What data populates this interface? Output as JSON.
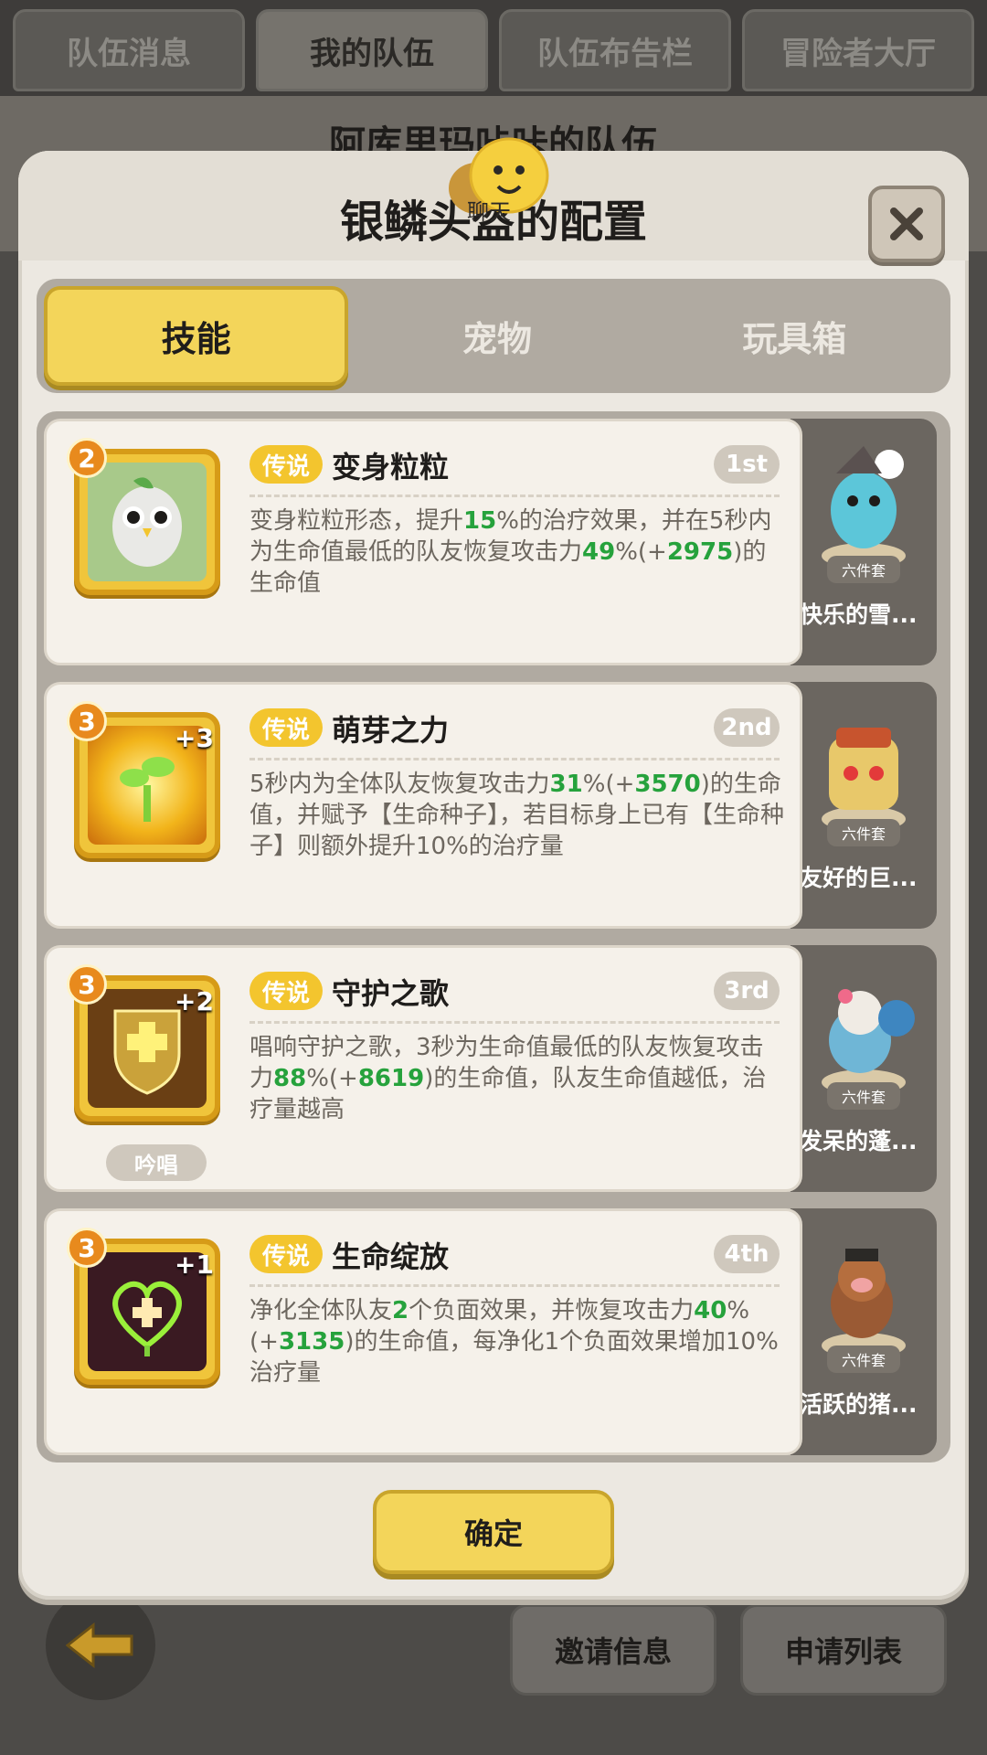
{
  "top_tabs": [
    {
      "label": "队伍消息"
    },
    {
      "label": "我的队伍",
      "active": true
    },
    {
      "label": "队伍布告栏"
    },
    {
      "label": "冒险者大厅"
    }
  ],
  "background_team_title": "阿库里玛咔咔的队伍",
  "modal": {
    "title": "银鳞头盔的配置",
    "chat_label": "聊天",
    "close_icon": "close-icon",
    "tabs": [
      {
        "label": "技能",
        "active": true
      },
      {
        "label": "宠物"
      },
      {
        "label": "玩具箱"
      }
    ],
    "skills": [
      {
        "level": "2",
        "plus": "",
        "rarity": "传说",
        "name": "变身粒粒",
        "rank": "1st",
        "desc": [
          "变身粒粒形态，提升",
          "15",
          "%的治疗效果，并在5秒内为生命值最低的队友恢复攻击力",
          "49",
          "%(+",
          "2975",
          ")的生命值"
        ],
        "chant": "",
        "pet": {
          "name": "快乐的雪...",
          "set": "六件套"
        }
      },
      {
        "level": "3",
        "plus": "+3",
        "rarity": "传说",
        "name": "萌芽之力",
        "rank": "2nd",
        "desc": [
          "5秒内为全体队友恢复攻击力",
          "31",
          "%(+",
          "3570",
          ")的生命值，并赋予【生命种子】，若目标身上已有【生命种子】则额外提升10%的治疗量"
        ],
        "chant": "",
        "pet": {
          "name": "友好的巨...",
          "set": "六件套"
        }
      },
      {
        "level": "3",
        "plus": "+2",
        "rarity": "传说",
        "name": "守护之歌",
        "rank": "3rd",
        "desc": [
          "唱响守护之歌，3秒为生命值最低的队友恢复攻击力",
          "88",
          "%(+",
          "8619",
          ")的生命值，队友生命值越低，治疗量越高"
        ],
        "chant": "吟唱",
        "pet": {
          "name": "发呆的蓬...",
          "set": "六件套"
        }
      },
      {
        "level": "3",
        "plus": "+1",
        "rarity": "传说",
        "name": "生命绽放",
        "rank": "4th",
        "desc": [
          "净化全体队友",
          "2",
          "个负面效果，并恢复攻击力",
          "40",
          "%(+",
          "3135",
          ")的生命值，每净化1个负面效果增加10%治疗量"
        ],
        "chant": "",
        "pet": {
          "name": "活跃的猪...",
          "set": "六件套"
        }
      }
    ],
    "confirm_label": "确定"
  },
  "bottom_buttons": [
    {
      "label": "邀请信息"
    },
    {
      "label": "申请列表"
    }
  ],
  "colors": {
    "accent_yellow": "#f3d55a",
    "highlight_green": "#26a23c",
    "badge_orange": "#e88a1d"
  }
}
